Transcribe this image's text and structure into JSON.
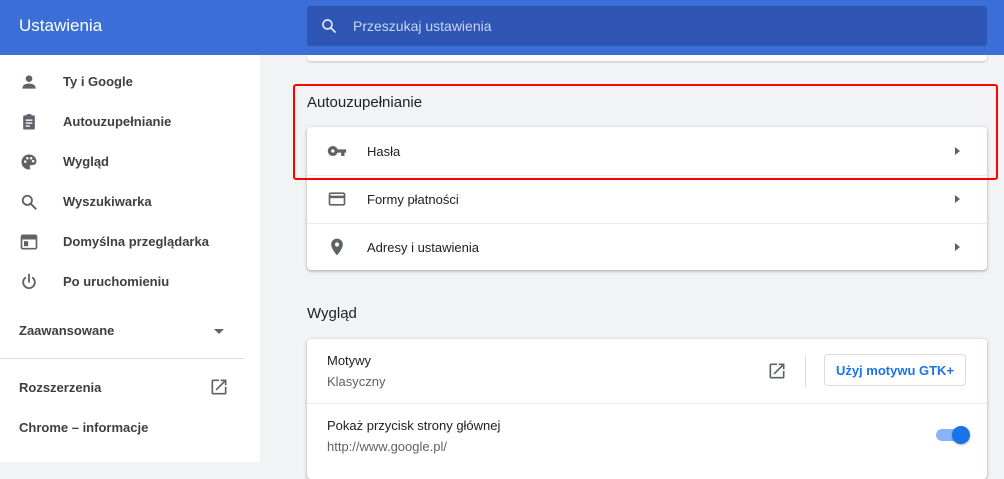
{
  "header": {
    "title": "Ustawienia",
    "search_placeholder": "Przeszukaj ustawienia",
    "search_value": ""
  },
  "sidebar": {
    "items": [
      {
        "label": "Ty i Google",
        "icon": "person-icon"
      },
      {
        "label": "Autouzupełnianie",
        "icon": "clipboard-icon"
      },
      {
        "label": "Wygląd",
        "icon": "palette-icon"
      },
      {
        "label": "Wyszukiwarka",
        "icon": "search-icon"
      },
      {
        "label": "Domyślna przeglądarka",
        "icon": "browser-icon"
      },
      {
        "label": "Po uruchomieniu",
        "icon": "power-icon"
      }
    ],
    "advanced_label": "Zaawansowane",
    "extensions_label": "Rozszerzenia",
    "about_label": "Chrome – informacje"
  },
  "autofill": {
    "section_title": "Autouzupełnianie",
    "rows": [
      {
        "label": "Hasła",
        "icon": "key-icon"
      },
      {
        "label": "Formy płatności",
        "icon": "credit-card-icon"
      },
      {
        "label": "Adresy i ustawienia",
        "icon": "location-pin-icon"
      }
    ]
  },
  "appearance": {
    "section_title": "Wygląd",
    "themes_title": "Motywy",
    "themes_value": "Klasyczny",
    "gtk_button_label": "Użyj motywu GTK+",
    "home_button_title": "Pokaż przycisk strony głównej",
    "home_button_url": "http://www.google.pl/",
    "home_button_enabled": true
  },
  "colors": {
    "header_bg": "#3b6fd7",
    "search_bg": "#2f55b5",
    "accent": "#1a73e8",
    "highlight": "#ff0000"
  }
}
